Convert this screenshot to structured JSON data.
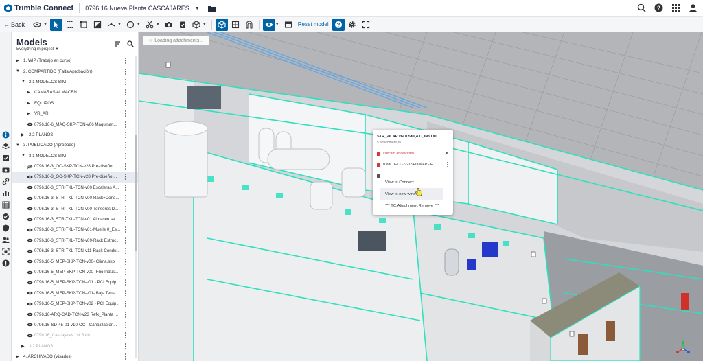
{
  "app": {
    "brand": "Trimble Connect",
    "project": "0796.16 Nueva Planta CASCAJARES"
  },
  "toolbar": {
    "back_label": "Back",
    "reset_label": "Reset model"
  },
  "panel": {
    "title": "Models",
    "filter": "Everything in project",
    "items": [
      {
        "label": "1. WIP (Trabajo en curso)",
        "level": 0,
        "kind": "folder",
        "open": false
      },
      {
        "label": "2. COMPARTIDO (Falta Aprobación)",
        "level": 0,
        "kind": "folder",
        "open": true
      },
      {
        "label": "2.1 MODELOS BIM",
        "level": 1,
        "kind": "folder",
        "open": true
      },
      {
        "label": "CAMARAS ALMACEN",
        "level": 2,
        "kind": "folder",
        "open": false
      },
      {
        "label": "EQUIPOS",
        "level": 2,
        "kind": "folder",
        "open": false
      },
      {
        "label": "VR_AR",
        "level": 2,
        "kind": "folder",
        "open": false
      },
      {
        "label": "0796.16-6_MAQ-SKP-TCN-v06 Maquinari...",
        "level": 2,
        "kind": "model",
        "visible": true
      },
      {
        "label": "2.2 PLANOS",
        "level": 1,
        "kind": "folder",
        "open": false
      },
      {
        "label": "3. PUBLICADO (Aprobado)",
        "level": 0,
        "kind": "folder",
        "open": true
      },
      {
        "label": "3.1 MODELOS BIM",
        "level": 1,
        "kind": "folder",
        "open": true
      },
      {
        "label": "0796.16-3_OC-SKP-TCN-v28 Pre-diseño ...",
        "level": 2,
        "kind": "model",
        "visible": false
      },
      {
        "label": "0796.16-3_OC-SKP-TCN-v28 Pre-diseño ...",
        "level": 2,
        "kind": "model",
        "visible": true,
        "highlight": true
      },
      {
        "label": "0796.16-3_STR-TKL-TCN-v00 Escaleras A...",
        "level": 2,
        "kind": "model",
        "visible": true
      },
      {
        "label": "0796.16-3_STR-TKL-TCN-v00-Rack+Cond...",
        "level": 2,
        "kind": "model",
        "visible": true
      },
      {
        "label": "0796.16-3_STR-TKL-TCN-v00-Tensores D...",
        "level": 2,
        "kind": "model",
        "visible": true
      },
      {
        "label": "0796.16-3_STR-TKL-TCN-v01 Almacen se...",
        "level": 2,
        "kind": "model",
        "visible": true
      },
      {
        "label": "0796.16-3_STR-TKL-TCN-v01-Muelle 0_Es...",
        "level": 2,
        "kind": "model",
        "visible": true
      },
      {
        "label": "0796.16-3_STR-TKL-TCN-v09-Rack Estruc...",
        "level": 2,
        "kind": "model",
        "visible": true
      },
      {
        "label": "0796.16-3_STR-TKL-TCN-v11-Rack Condu...",
        "level": 2,
        "kind": "model",
        "visible": true
      },
      {
        "label": "0796.16-5_MEP-SKP-TCN-v00- Clima.skp",
        "level": 2,
        "kind": "model",
        "visible": true
      },
      {
        "label": "0796.16-5_MEP-SKP-TCN-v00- Frio Indus...",
        "level": 2,
        "kind": "model",
        "visible": true
      },
      {
        "label": "0796.16-5_MEP-SKP-TCN-v01 - PCI Equip...",
        "level": 2,
        "kind": "model",
        "visible": true
      },
      {
        "label": "0796.16-5_MEP-SKP-TCN-v01- Baja Tensi...",
        "level": 2,
        "kind": "model",
        "visible": true
      },
      {
        "label": "0796.16-5_MEP-SKP-TCN-v02 - PCI Equip...",
        "level": 2,
        "kind": "model",
        "visible": true
      },
      {
        "label": "0796.16-ARQ-CAD-TCN-v23 Refx_Planta ...",
        "level": 2,
        "kind": "model",
        "visible": true
      },
      {
        "label": "0796.16-SD-45-01-v10-OC - Canalizacion...",
        "level": 2,
        "kind": "model",
        "visible": true
      },
      {
        "label": "0796.16_Cascajares 1st 5.trb",
        "level": 2,
        "kind": "model",
        "visible": true,
        "dim": true
      },
      {
        "label": "3.2 PLANOS",
        "level": 1,
        "kind": "folder",
        "open": false,
        "dim": true
      },
      {
        "label": "4. ARCHIVADO (Visados)",
        "level": 0,
        "kind": "folder",
        "open": false
      }
    ]
  },
  "viewer": {
    "status": "Loading attachments..."
  },
  "popup": {
    "title": "STR_PILAR HP 0,5X0,4 C_INST#1",
    "subtitle": "5 attachment(s)",
    "link_text": "cascam.atta/0cvarn",
    "file_text": "0796.16-CL-22-02-PO-MEP - E...",
    "menu": [
      "View in Connect",
      "View in new window",
      "*** TC.Attachment.Remove ***"
    ]
  },
  "colors": {
    "accent": "#0063a3",
    "selection_edge": "#2de0c0",
    "highlight_row": "#e7eaf0"
  }
}
